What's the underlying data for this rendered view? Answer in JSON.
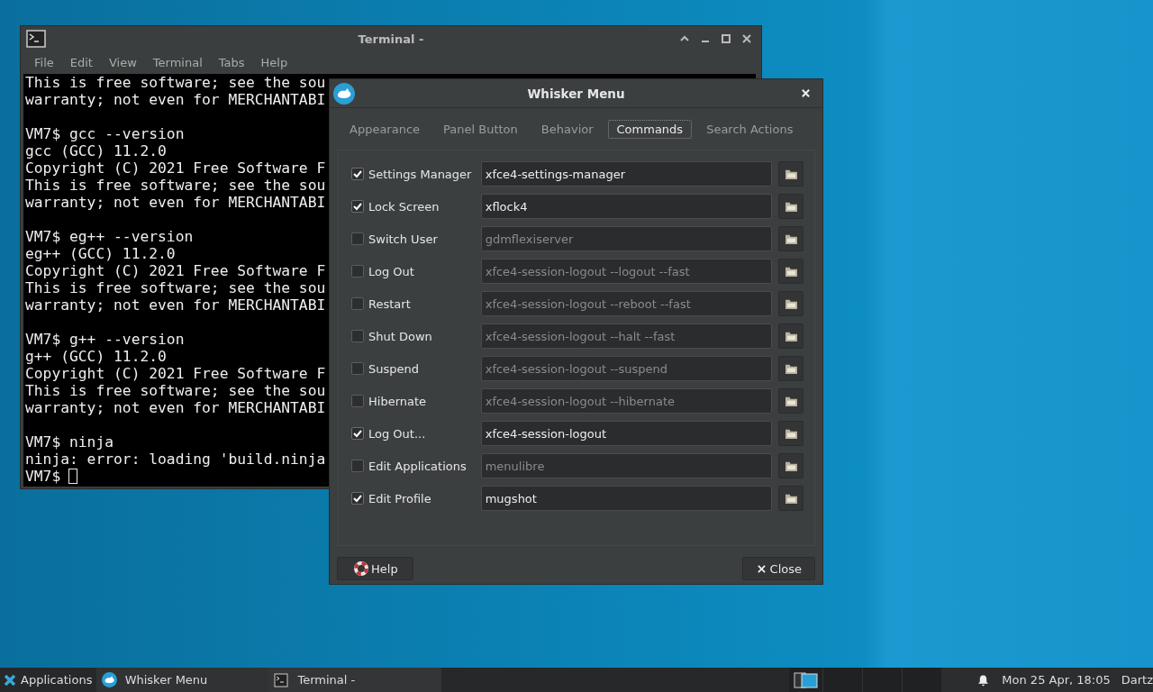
{
  "terminal": {
    "title": "Terminal -",
    "menu": [
      "File",
      "Edit",
      "View",
      "Terminal",
      "Tabs",
      "Help"
    ],
    "blocks": [
      [
        "This is free software; see the sou",
        "warranty; not even for MERCHANTABI"
      ],
      [
        "VM7$ gcc --version",
        "gcc (GCC) 11.2.0",
        "Copyright (C) 2021 Free Software F",
        "This is free software; see the sou",
        "warranty; not even for MERCHANTABI"
      ],
      [
        "VM7$ eg++ --version",
        "eg++ (GCC) 11.2.0",
        "Copyright (C) 2021 Free Software F",
        "This is free software; see the sou",
        "warranty; not even for MERCHANTABI"
      ],
      [
        "VM7$ g++ --version",
        "g++ (GCC) 11.2.0",
        "Copyright (C) 2021 Free Software F",
        "This is free software; see the sou",
        "warranty; not even for MERCHANTABI"
      ],
      [
        "VM7$ ninja",
        "ninja: error: loading 'build.ninja"
      ]
    ],
    "prompt": "VM7$"
  },
  "dialog": {
    "title": "Whisker Menu",
    "tabs": [
      {
        "label": "Appearance",
        "selected": false
      },
      {
        "label": "Panel Button",
        "selected": false
      },
      {
        "label": "Behavior",
        "selected": false
      },
      {
        "label": "Commands",
        "selected": true
      },
      {
        "label": "Search Actions",
        "selected": false
      }
    ],
    "commands": [
      {
        "label": "Settings Manager",
        "checked": true,
        "value": "xfce4-settings-manager"
      },
      {
        "label": "Lock Screen",
        "checked": true,
        "value": "xflock4"
      },
      {
        "label": "Switch User",
        "checked": false,
        "value": "gdmflexiserver"
      },
      {
        "label": "Log Out",
        "checked": false,
        "value": "xfce4-session-logout --logout --fast"
      },
      {
        "label": "Restart",
        "checked": false,
        "value": "xfce4-session-logout --reboot --fast"
      },
      {
        "label": "Shut Down",
        "checked": false,
        "value": "xfce4-session-logout --halt --fast"
      },
      {
        "label": "Suspend",
        "checked": false,
        "value": "xfce4-session-logout --suspend"
      },
      {
        "label": "Hibernate",
        "checked": false,
        "value": "xfce4-session-logout --hibernate"
      },
      {
        "label": "Log Out...",
        "checked": true,
        "value": "xfce4-session-logout"
      },
      {
        "label": "Edit Applications",
        "checked": false,
        "value": "menulibre"
      },
      {
        "label": "Edit Profile",
        "checked": true,
        "value": "mugshot"
      }
    ],
    "help_button": "Help",
    "close_button": "Close"
  },
  "taskbar": {
    "applications": "Applications",
    "tasks": [
      {
        "label": "Whisker Menu",
        "kind": "whisker"
      },
      {
        "label": "Terminal -",
        "kind": "terminal"
      }
    ],
    "clock": "Mon 25 Apr, 18:05",
    "user": "Dartz"
  }
}
